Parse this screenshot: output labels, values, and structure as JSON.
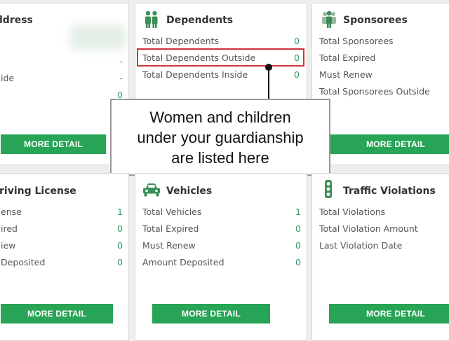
{
  "cards": {
    "address": {
      "title": "ldress",
      "rows": [
        {
          "label": "",
          "value": "-"
        },
        {
          "label": "ide",
          "value": "-"
        },
        {
          "label": "",
          "value": "0"
        }
      ],
      "button": "MORE DETAIL"
    },
    "dependents": {
      "title": "Dependents",
      "icon": "family-icon",
      "rows": [
        {
          "label": "Total Dependents",
          "value": "0"
        },
        {
          "label": "Total Dependents Outside",
          "value": "0"
        },
        {
          "label": "Total Dependents Inside",
          "value": "0"
        }
      ],
      "button": "MORE DETAIL"
    },
    "sponsorees": {
      "title": "Sponsorees",
      "icon": "people-icon",
      "rows": [
        {
          "label": "Total Sponsorees"
        },
        {
          "label": "Total Expired"
        },
        {
          "label": "Must Renew"
        },
        {
          "label": "Total Sponsorees Outside"
        }
      ],
      "button": "MORE DETAIL"
    },
    "driving_license": {
      "title": "riving License",
      "rows": [
        {
          "label": "ense",
          "value": "1"
        },
        {
          "label": "ired",
          "value": "0"
        },
        {
          "label": "iew",
          "value": "0"
        },
        {
          "label": "Deposited",
          "value": "0"
        }
      ],
      "button": "MORE DETAIL"
    },
    "vehicles": {
      "title": "Vehicles",
      "icon": "car-icon",
      "rows": [
        {
          "label": "Total Vehicles",
          "value": "1"
        },
        {
          "label": "Total Expired",
          "value": "0"
        },
        {
          "label": "Must Renew",
          "value": "0"
        },
        {
          "label": "Amount Deposited",
          "value": "0"
        }
      ],
      "button": "MORE DETAIL"
    },
    "traffic": {
      "title": "Traffic Violations",
      "icon": "traffic-light-icon",
      "rows": [
        {
          "label": "Total Violations"
        },
        {
          "label": "Total Violation Amount"
        },
        {
          "label": "Last Violation Date"
        }
      ],
      "button": "MORE DETAIL"
    }
  },
  "callout": {
    "line1": "Women and children",
    "line2": "under your guardianship",
    "line3": "are listed here"
  },
  "colors": {
    "accent": "#27a455",
    "highlight": "#d0333a"
  }
}
